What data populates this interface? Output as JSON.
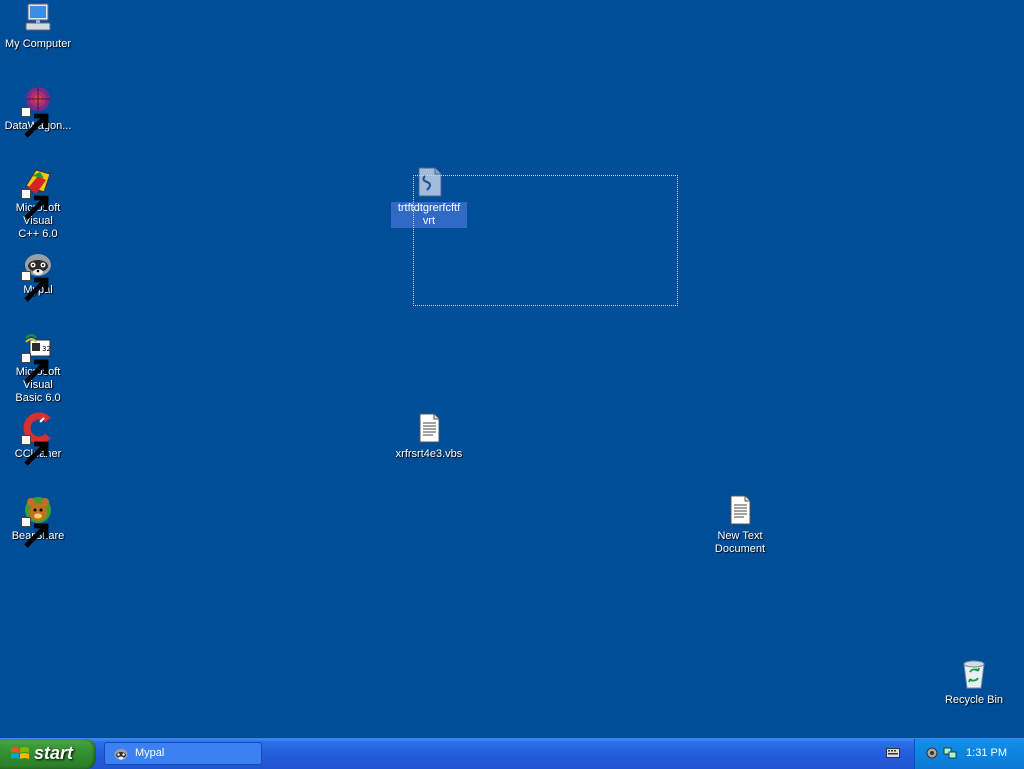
{
  "desktop_icons": {
    "my_computer": "My Computer",
    "datawagon": "DataWagon...",
    "msvc_line1": "Microsoft Visual",
    "msvc_line2": "C++ 6.0",
    "mypal": "Mypal",
    "msvb_line1": "Microsoft Visual",
    "msvb_line2": "Basic 6.0",
    "ccleaner": "CCleaner",
    "bearshare": "BearShare",
    "script_file_line1": "trtftdtgrerfcftf",
    "script_file_line2": "vrt",
    "vbs_file": "xrfrsrt4e3.vbs",
    "new_text_line1": "New Text",
    "new_text_line2": "Document",
    "recycle_bin": "Recycle Bin"
  },
  "taskbar": {
    "start_label": "start",
    "task_button_label": "Mypal",
    "clock": "1:31 PM"
  },
  "colors": {
    "desktop_bg": "#004e98",
    "taskbar_blue": "#245edb",
    "start_green": "#3d9b3a",
    "tray_blue": "#0e84e0",
    "selection_blue": "#316ac5"
  },
  "icon_names": {
    "my_computer": "computer-icon",
    "datawagon": "datawagon-icon",
    "msvc": "visual-cpp-icon",
    "mypal": "raccoon-icon",
    "msvb": "visual-basic-icon",
    "ccleaner": "ccleaner-icon",
    "bearshare": "bear-icon",
    "script_file": "script-file-icon",
    "vbs_file": "text-file-icon",
    "new_text": "text-file-icon",
    "recycle_bin": "recycle-bin-icon"
  }
}
